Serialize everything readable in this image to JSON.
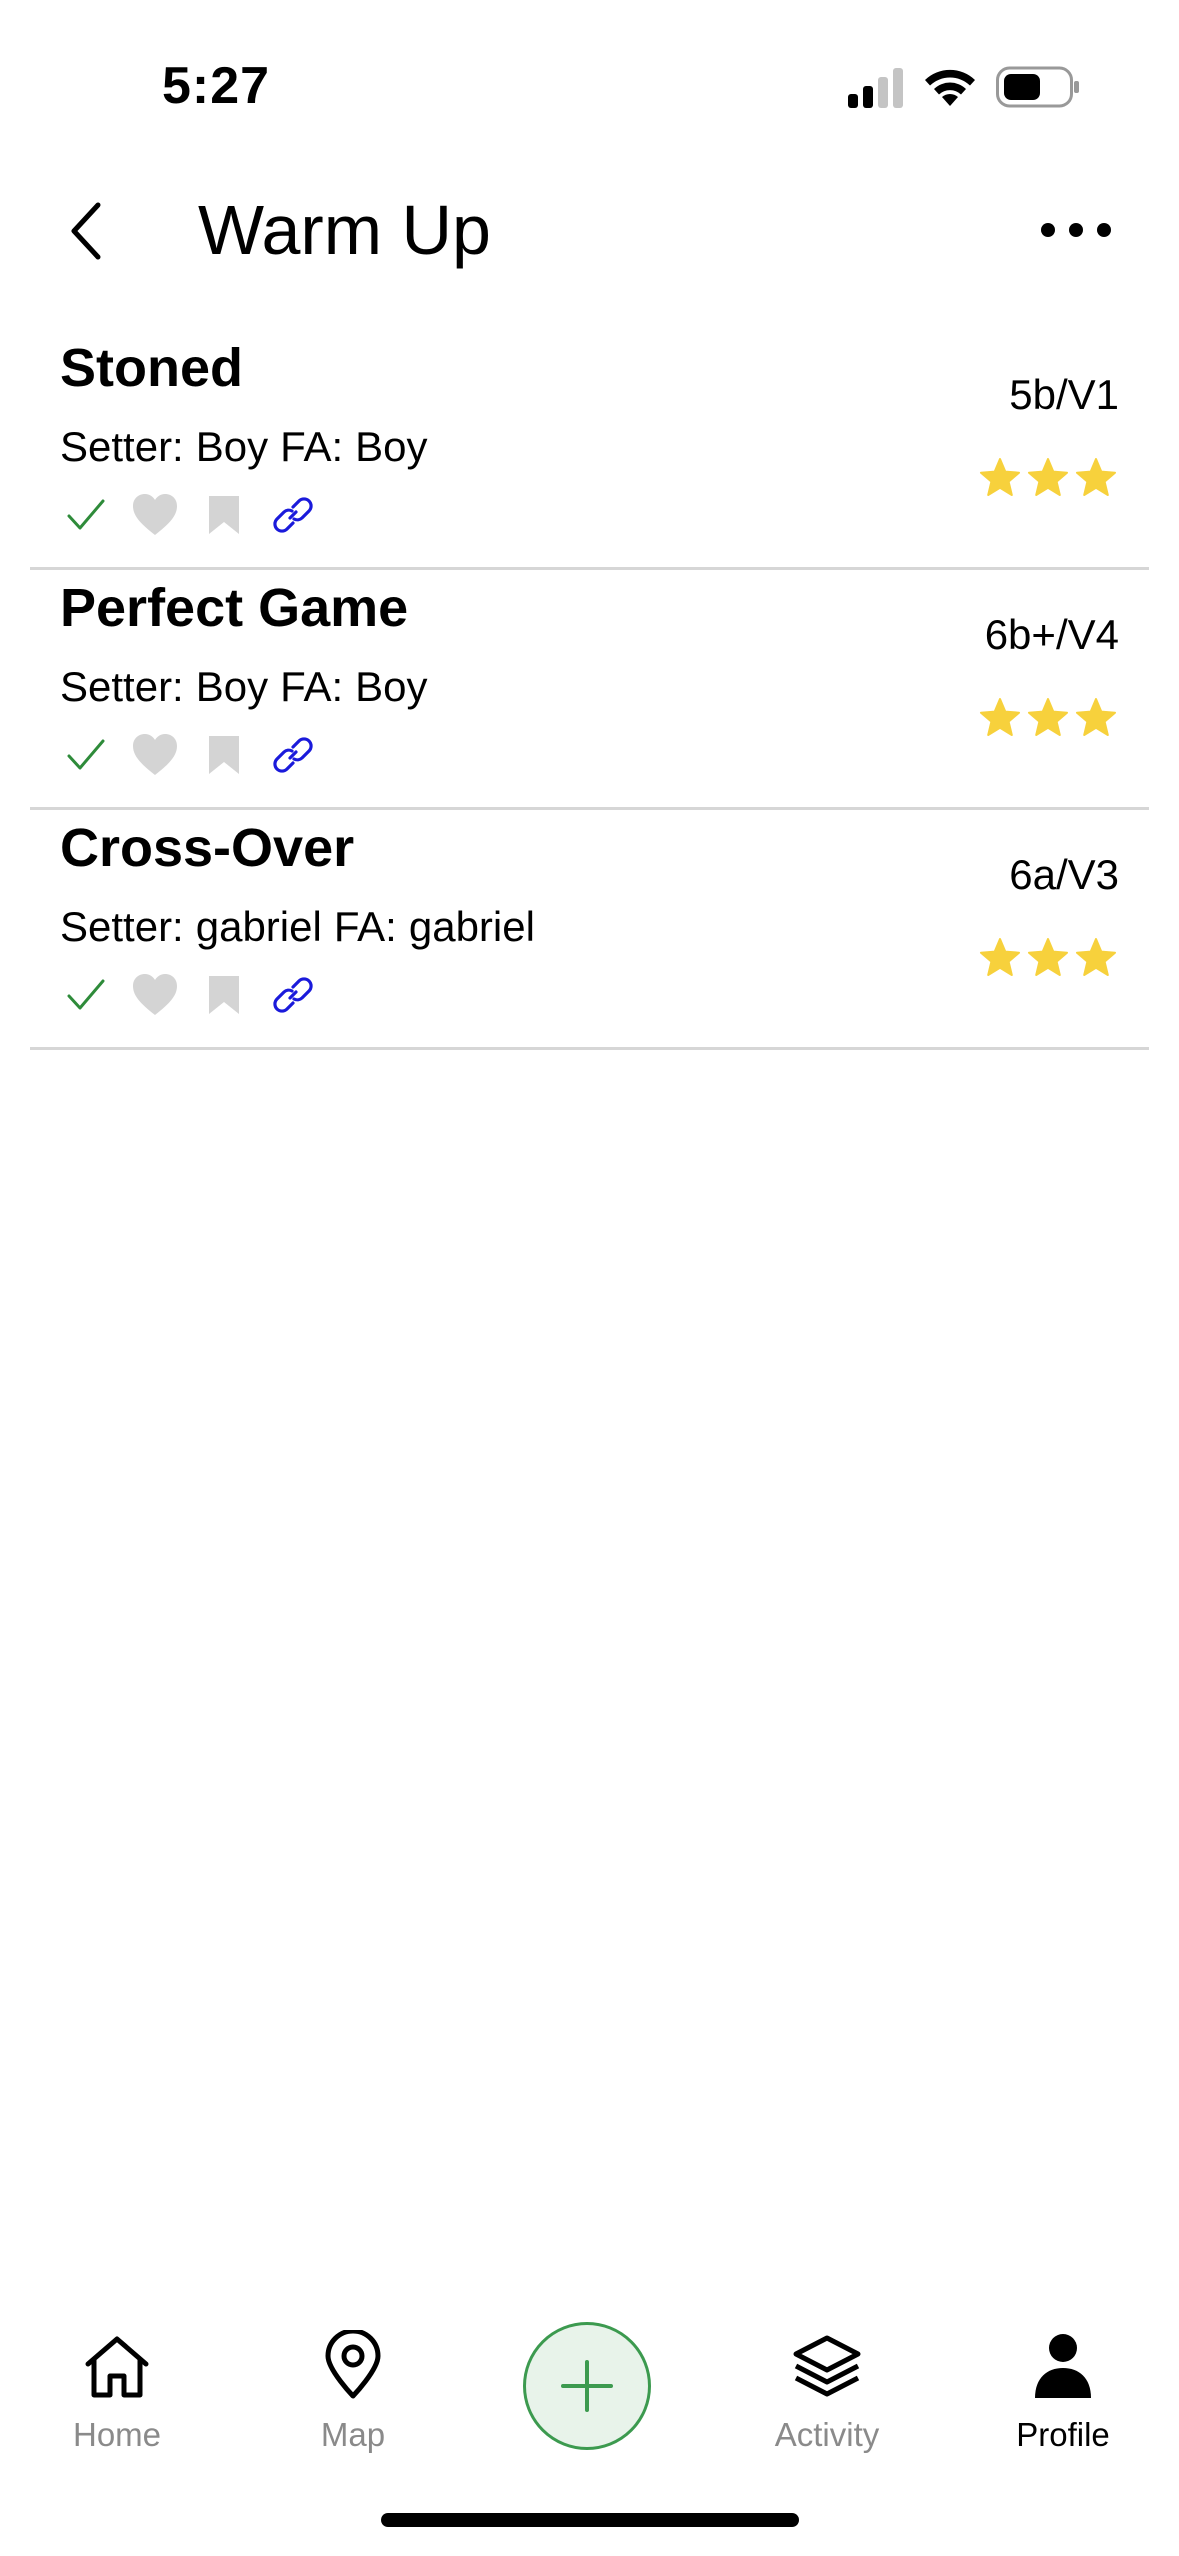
{
  "status_bar": {
    "time": "5:27"
  },
  "header": {
    "title": "Warm Up"
  },
  "routes": [
    {
      "name": "Stoned",
      "setter_label": "Setter:",
      "setter": "Boy",
      "fa_label": "FA:",
      "fa": "Boy",
      "grade": "5b/V1",
      "stars": 3
    },
    {
      "name": "Perfect Game",
      "setter_label": "Setter:",
      "setter": "Boy",
      "fa_label": "FA:",
      "fa": "Boy",
      "grade": "6b+/V4",
      "stars": 3
    },
    {
      "name": "Cross-Over",
      "setter_label": "Setter:",
      "setter": "gabriel",
      "fa_label": "FA:",
      "fa": "gabriel",
      "grade": "6a/V3",
      "stars": 3
    }
  ],
  "tab_bar": {
    "tabs": [
      {
        "label": "Home",
        "icon": "home-icon"
      },
      {
        "label": "Map",
        "icon": "map-pin-icon"
      },
      {
        "label": "",
        "icon": "plus-icon"
      },
      {
        "label": "Activity",
        "icon": "layers-icon"
      },
      {
        "label": "Profile",
        "icon": "person-icon"
      }
    ],
    "active": "Profile"
  },
  "colors": {
    "check": "#2e8b3a",
    "inactive_icon": "#d4d4d4",
    "link": "#1a1adb",
    "star": "#f7d13c",
    "add_button_border": "#3c9a4f",
    "add_button_bg": "#e8f3ea",
    "divider": "#d6d6d6"
  }
}
